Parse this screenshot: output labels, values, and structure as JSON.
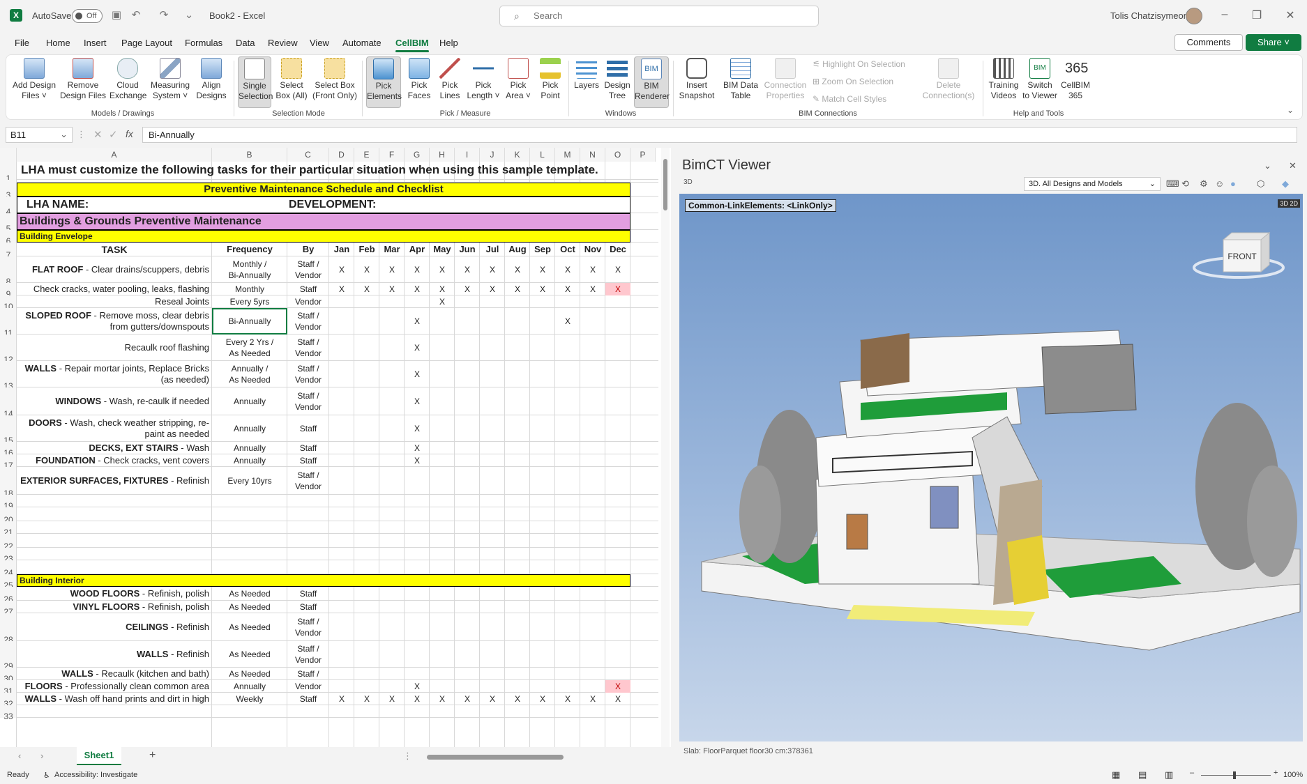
{
  "titlebar": {
    "autosave_label": "AutoSave",
    "autosave_state": "Off",
    "doc_title": "Book2 - Excel",
    "search_placeholder": "Search",
    "user_name": "Tolis Chatzisymeon"
  },
  "menu": {
    "items": [
      "File",
      "Home",
      "Insert",
      "Page Layout",
      "Formulas",
      "Data",
      "Review",
      "View",
      "Automate",
      "CellBIM",
      "Help"
    ],
    "active": "CellBIM",
    "comments_label": "Comments",
    "share_label": "Share"
  },
  "ribbon": {
    "buttons": [
      {
        "label1": "Add Design",
        "label2": "Files ˅"
      },
      {
        "label1": "Remove",
        "label2": "Design Files"
      },
      {
        "label1": "Cloud",
        "label2": "Exchange"
      },
      {
        "label1": "Measuring",
        "label2": "System ˅"
      },
      {
        "label1": "Align",
        "label2": "Designs"
      },
      {
        "label1": "Single",
        "label2": "Selection"
      },
      {
        "label1": "Select",
        "label2": "Box (All)"
      },
      {
        "label1": "Select Box",
        "label2": "(Front Only)"
      },
      {
        "label1": "Pick",
        "label2": "Elements"
      },
      {
        "label1": "Pick",
        "label2": "Faces"
      },
      {
        "label1": "Pick",
        "label2": "Lines"
      },
      {
        "label1": "Pick",
        "label2": "Length ˅"
      },
      {
        "label1": "Pick",
        "label2": "Area ˅"
      },
      {
        "label1": "Pick",
        "label2": "Point"
      },
      {
        "label1": "Layers",
        "label2": ""
      },
      {
        "label1": "Design",
        "label2": "Tree"
      },
      {
        "label1": "BIM",
        "label2": "Renderer"
      },
      {
        "label1": "Insert",
        "label2": "Snapshot"
      },
      {
        "label1": "BIM Data",
        "label2": "Table"
      },
      {
        "label1": "Connection",
        "label2": "Properties"
      },
      {
        "label1": "Delete",
        "label2": "Connection(s)"
      },
      {
        "label1": "Training",
        "label2": "Videos"
      },
      {
        "label1": "Switch",
        "label2": "to Viewer"
      },
      {
        "label1": "CellBIM",
        "label2": "365"
      }
    ],
    "small_buttons": [
      "Highlight On Selection",
      "Zoom On Selection",
      "Match Cell Styles"
    ],
    "groups": [
      "Models / Drawings",
      "Selection Mode",
      "Pick / Measure",
      "Windows",
      "BIM Connections",
      "Help and Tools"
    ]
  },
  "formula_bar": {
    "name_box": "B11",
    "fx": "fx",
    "value": "Bi-Annually"
  },
  "sheet": {
    "columns": [
      "A",
      "B",
      "C",
      "D",
      "E",
      "F",
      "G",
      "H",
      "I",
      "J",
      "K",
      "L",
      "M",
      "N",
      "O",
      "P"
    ],
    "row1": "LHA must customize the following tasks for their particular situation when using this sample template.",
    "row3": "Preventive Maintenance Schedule and Checklist",
    "row4_left": "LHA NAME:",
    "row4_right": "DEVELOPMENT:",
    "row5": "Buildings & Grounds Preventive Maintenance",
    "row6": "Building Envelope",
    "headers": [
      "TASK",
      "Frequency",
      "By",
      "Jan",
      "Feb",
      "Mar",
      "Apr",
      "May",
      "Jun",
      "Jul",
      "Aug",
      "Sep",
      "Oct",
      "Nov",
      "Dec"
    ],
    "row25": "Building Interior",
    "tasks": [
      {
        "row": "8",
        "bold": "FLAT ROOF",
        "text": " - Clear drains/scuppers, debris",
        "freq": [
          "Monthly /",
          "Bi-Annually"
        ],
        "by": [
          "Staff /",
          "Vendor"
        ],
        "x": [
          1,
          1,
          1,
          1,
          1,
          1,
          1,
          1,
          1,
          1,
          1,
          1
        ]
      },
      {
        "row": "9",
        "bold": "",
        "text": "Check cracks, water pooling, leaks, flashing",
        "freq": [
          "Monthly"
        ],
        "by": [
          "Staff"
        ],
        "x": [
          1,
          1,
          1,
          1,
          1,
          1,
          1,
          1,
          1,
          1,
          1,
          1
        ]
      },
      {
        "row": "10",
        "bold": "",
        "text": "Reseal Joints",
        "freq": [
          "Every 5yrs"
        ],
        "by": [
          "Vendor"
        ],
        "x": [
          0,
          0,
          0,
          0,
          1,
          0,
          0,
          0,
          0,
          0,
          0,
          0
        ]
      },
      {
        "row": "11",
        "bold": "SLOPED ROOF",
        "text": " - Remove moss, clear debris",
        "text2": "from gutters/downspouts",
        "freq": [
          "Bi-Annually"
        ],
        "by": [
          "Staff /",
          "Vendor"
        ],
        "x": [
          0,
          0,
          0,
          1,
          0,
          0,
          0,
          0,
          0,
          1,
          0,
          0
        ]
      },
      {
        "row": "12",
        "bold": "",
        "text": "Recaulk roof flashing",
        "freq": [
          "Every 2 Yrs /",
          "As Needed"
        ],
        "by": [
          "Staff /",
          "Vendor"
        ],
        "x": [
          0,
          0,
          0,
          1,
          0,
          0,
          0,
          0,
          0,
          0,
          0,
          0
        ]
      },
      {
        "row": "13",
        "bold": "WALLS",
        "text": " - Repair mortar joints, Replace Bricks",
        "text2": "(as needed)",
        "freq": [
          "Annually /",
          "As Needed"
        ],
        "by": [
          "Staff /",
          "Vendor"
        ],
        "x": [
          0,
          0,
          0,
          1,
          0,
          0,
          0,
          0,
          0,
          0,
          0,
          0
        ]
      },
      {
        "row": "14",
        "bold": "WINDOWS",
        "text": " - Wash, re-caulk if needed",
        "freq": [
          "Annually"
        ],
        "by": [
          "Staff /",
          "Vendor"
        ],
        "x": [
          0,
          0,
          0,
          1,
          0,
          0,
          0,
          0,
          0,
          0,
          0,
          0
        ]
      },
      {
        "row": "15",
        "bold": "DOORS",
        "text": " - Wash, check weather stripping, re-",
        "text2": "paint as needed",
        "freq": [
          "Annually"
        ],
        "by": [
          "Staff"
        ],
        "x": [
          0,
          0,
          0,
          1,
          0,
          0,
          0,
          0,
          0,
          0,
          0,
          0
        ]
      },
      {
        "row": "16",
        "bold": "DECKS, EXT STAIRS",
        "text": " - Wash",
        "freq": [
          "Annually"
        ],
        "by": [
          "Staff"
        ],
        "x": [
          0,
          0,
          0,
          1,
          0,
          0,
          0,
          0,
          0,
          0,
          0,
          0
        ]
      },
      {
        "row": "17",
        "bold": "FOUNDATION",
        "text": " - Check cracks, vent covers",
        "freq": [
          "Annually"
        ],
        "by": [
          "Staff"
        ],
        "x": [
          0,
          0,
          0,
          1,
          0,
          0,
          0,
          0,
          0,
          0,
          0,
          0
        ]
      },
      {
        "row": "18",
        "bold": "EXTERIOR SURFACES, FIXTURES",
        "text": " - Refinish",
        "freq": [
          "Every 10yrs"
        ],
        "by": [
          "Staff /",
          "Vendor"
        ],
        "x": [
          0,
          0,
          0,
          0,
          0,
          0,
          0,
          0,
          0,
          0,
          0,
          0
        ]
      }
    ],
    "interior": [
      {
        "row": "26",
        "bold": "WOOD FLOORS",
        "text": " - Refinish, polish",
        "freq": [
          "As Needed"
        ],
        "by": [
          "Staff"
        ],
        "x": [
          0,
          0,
          0,
          0,
          0,
          0,
          0,
          0,
          0,
          0,
          0,
          0
        ]
      },
      {
        "row": "27",
        "bold": "VINYL FLOORS",
        "text": " - Refinish, polish",
        "freq": [
          "As Needed"
        ],
        "by": [
          "Staff"
        ],
        "x": [
          0,
          0,
          0,
          0,
          0,
          0,
          0,
          0,
          0,
          0,
          0,
          0
        ]
      },
      {
        "row": "28",
        "bold": "CEILINGS",
        "text": " - Refinish",
        "freq": [
          "As Needed"
        ],
        "by": [
          "Staff /",
          "Vendor"
        ],
        "x": [
          0,
          0,
          0,
          0,
          0,
          0,
          0,
          0,
          0,
          0,
          0,
          0
        ]
      },
      {
        "row": "29",
        "bold": "WALLS",
        "text": " - Refinish",
        "freq": [
          "As Needed"
        ],
        "by": [
          "Staff /",
          "Vendor"
        ],
        "x": [
          0,
          0,
          0,
          0,
          0,
          0,
          0,
          0,
          0,
          0,
          0,
          0
        ]
      },
      {
        "row": "30",
        "bold": "WALLS",
        "text": " - Recaulk (kitchen and bath)",
        "freq": [
          "As Needed"
        ],
        "by": [
          "Staff /"
        ],
        "x": [
          0,
          0,
          0,
          0,
          0,
          0,
          0,
          0,
          0,
          0,
          0,
          0
        ]
      },
      {
        "row": "31",
        "bold": "FLOORS",
        "text": " - Professionally clean common area",
        "freq": [
          "Annually"
        ],
        "by": [
          "Vendor"
        ],
        "x": [
          0,
          0,
          0,
          1,
          0,
          0,
          0,
          0,
          0,
          0,
          0,
          1
        ]
      },
      {
        "row": "32",
        "bold": "WALLS",
        "text": " - Wash off hand prints and dirt in high",
        "freq": [
          "Weekly"
        ],
        "by": [
          "Staff"
        ],
        "x": [
          1,
          1,
          1,
          1,
          1,
          1,
          1,
          1,
          1,
          1,
          1,
          1
        ]
      }
    ],
    "x_mark": "X",
    "tab_name": "Sheet1"
  },
  "viewer": {
    "title": "BimCT Viewer",
    "sub": "3D",
    "select_value": "3D. All Designs and Models",
    "scene_label": "Common-LinkElements: <LinkOnly>",
    "cube_label": "FRONT",
    "badge": "3D 2D",
    "status": "Slab: FloorParquet floor30 cm:378361"
  },
  "status": {
    "ready": "Ready",
    "accessibility": "Accessibility: Investigate",
    "zoom": "100%"
  },
  "colors": {
    "excel_green": "#107c41",
    "yellow": "#ffff00",
    "pink": "#e29ee0",
    "error_red_bg": "#ffc7ce"
  }
}
